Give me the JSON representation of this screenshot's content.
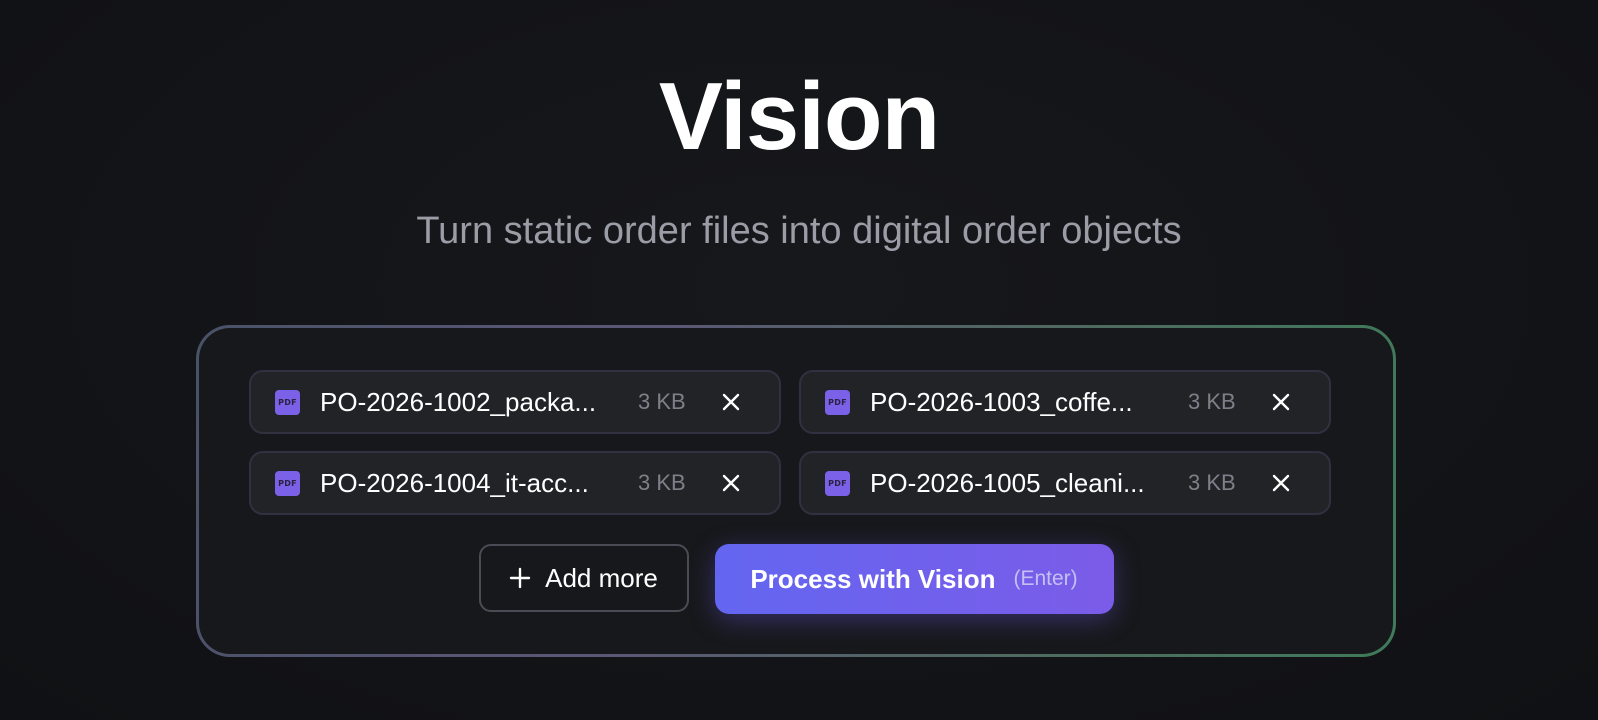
{
  "header": {
    "title": "Vision",
    "subtitle": "Turn static order files into digital order objects"
  },
  "files": [
    {
      "name": "PO-2026-1002_packa...",
      "size": "3 KB",
      "type_label": "PDF",
      "icon": "pdf-file-icon"
    },
    {
      "name": "PO-2026-1003_coffe...",
      "size": "3 KB",
      "type_label": "PDF",
      "icon": "pdf-file-icon"
    },
    {
      "name": "PO-2026-1004_it-acc...",
      "size": "3 KB",
      "type_label": "PDF",
      "icon": "pdf-file-icon"
    },
    {
      "name": "PO-2026-1005_cleani...",
      "size": "3 KB",
      "type_label": "PDF",
      "icon": "pdf-file-icon"
    }
  ],
  "actions": {
    "add_more_label": "Add more",
    "add_more_icon": "plus-icon",
    "process_label": "Process with Vision",
    "process_hint": "(Enter)"
  },
  "colors": {
    "background": "#121316",
    "accent_start": "#6366f1",
    "accent_end": "#7b5ce8",
    "pdf_icon": "#7b61e8",
    "panel_border_green": "#3f7a5a"
  }
}
